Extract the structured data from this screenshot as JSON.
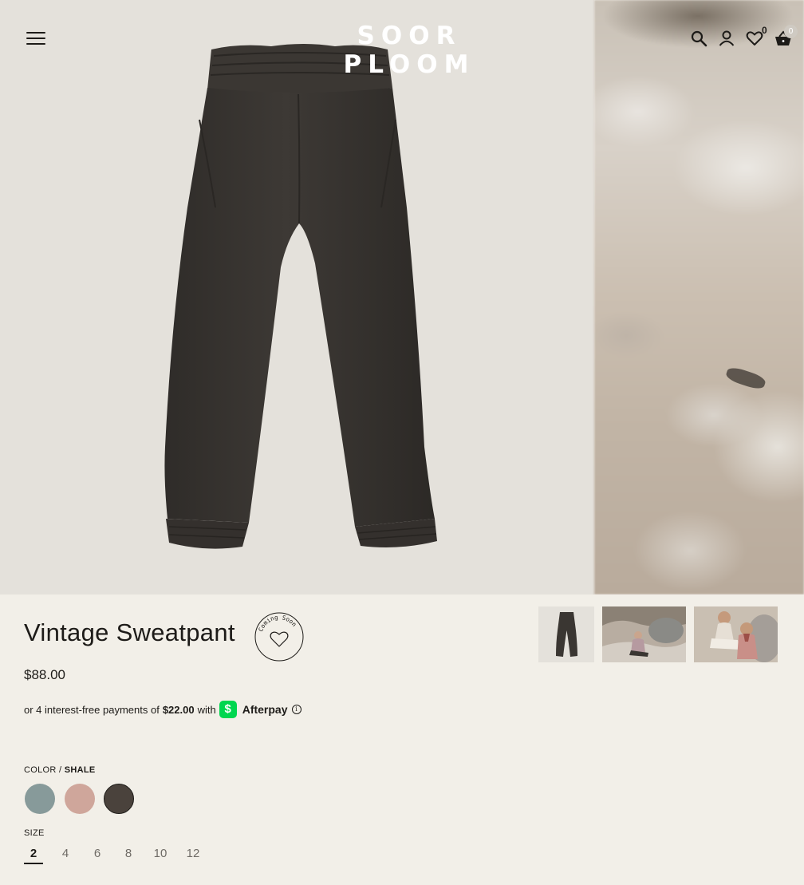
{
  "header": {
    "logo": "SOOR PLOOM",
    "wishlist_count": "0",
    "cart_count": "0"
  },
  "product": {
    "title": "Vintage Sweatpant",
    "badge": "Coming Soon",
    "price": "$88.00",
    "afterpay": {
      "prefix": "or 4 interest-free payments of",
      "amount": "$22.00",
      "with": "with",
      "brand": "Afterpay",
      "cash_icon": "$"
    },
    "color": {
      "label": "COLOR /",
      "selected": "SHALE",
      "swatches": [
        {
          "name": "blue-grey",
          "hex": "#879a9a"
        },
        {
          "name": "rose",
          "hex": "#cfa69b"
        },
        {
          "name": "shale",
          "hex": "#4a423c"
        }
      ]
    },
    "size": {
      "label": "SIZE",
      "options": [
        "2",
        "4",
        "6",
        "8",
        "10",
        "12"
      ],
      "selected": "2"
    }
  },
  "icons": {
    "menu": "menu-icon",
    "search": "search-icon",
    "account": "user-icon",
    "wishlist": "heart-icon",
    "cart": "basket-icon",
    "info": "info-icon"
  },
  "colors": {
    "page_bg": "#f2efe8",
    "hero_bg": "#e4e1db",
    "garment": "#3a3632",
    "text": "#1d1b18",
    "afterpay_green": "#00d64f"
  }
}
